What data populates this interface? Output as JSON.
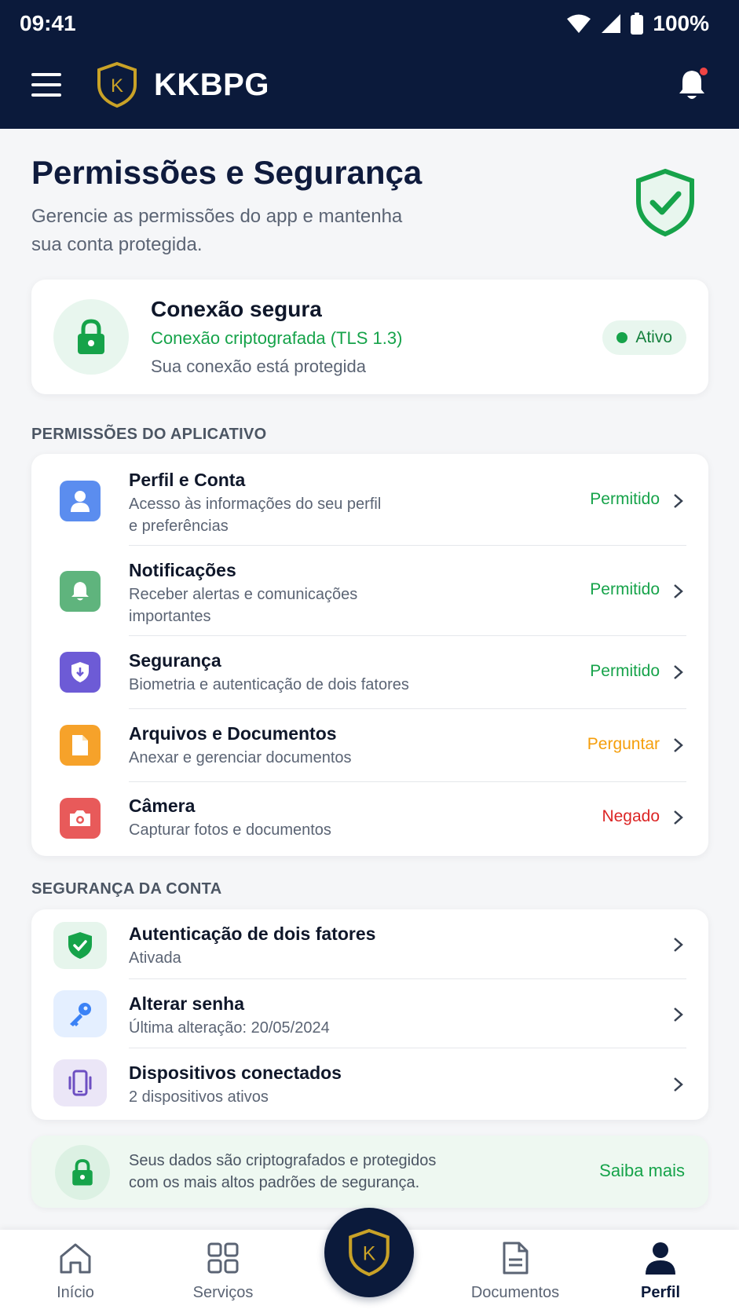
{
  "status_bar": {
    "time": "09:41",
    "battery": "100%"
  },
  "app": {
    "title": "KKBPG",
    "logo_letter": "K"
  },
  "page": {
    "title": "Permissões e Segurança",
    "subtitle_line1": "Gerencie as permissões do app e mantenha",
    "subtitle_line2": "sua conta protegida."
  },
  "connection": {
    "title": "Conexão segura",
    "subtitle": "Conexão criptografada (TLS 1.3)",
    "description": "Sua conexão está protegida",
    "badge": "Ativo"
  },
  "app_permissions": {
    "section_label": "PERMISSÕES DO APLICATIVO",
    "items": [
      {
        "title": "Perfil e Conta",
        "desc_line1": "Acesso às informações do seu perfil",
        "desc_line2": "e preferências",
        "status": "Permitido"
      },
      {
        "title": "Notificações",
        "desc_line1": "Receber alertas e comunicações",
        "desc_line2": "importantes",
        "status": "Permitido"
      },
      {
        "title": "Segurança",
        "desc_line1": "Biometria e autenticação de dois fatores",
        "status": "Permitido"
      },
      {
        "title": "Arquivos e Documentos",
        "desc_line1": "Anexar e gerenciar documentos",
        "status": "Perguntar"
      },
      {
        "title": "Câmera",
        "desc_line1": "Capturar fotos e documentos",
        "status": "Negado"
      }
    ]
  },
  "account_security": {
    "section_label": "SEGURANÇA DA CONTA",
    "items": [
      {
        "title": "Autenticação de dois fatores",
        "desc": "Ativada"
      },
      {
        "title": "Alterar senha",
        "desc": "Última alteração: 20/05/2024"
      },
      {
        "title": "Dispositivos conectados",
        "desc": "2 dispositivos ativos"
      }
    ]
  },
  "info_banner": {
    "line1": "Seus dados são criptografados e protegidos",
    "line2": "com os mais altos padrões de segurança.",
    "link": "Saiba mais"
  },
  "bottom_nav": {
    "home": "Início",
    "services": "Serviços",
    "documents": "Documentos",
    "profile": "Perfil",
    "center_letter": "K"
  },
  "colors": {
    "navy": "#0b1a3b",
    "green": "#16a34a",
    "orange": "#f59e0b",
    "red": "#dc2626",
    "gold": "#c9a227"
  }
}
